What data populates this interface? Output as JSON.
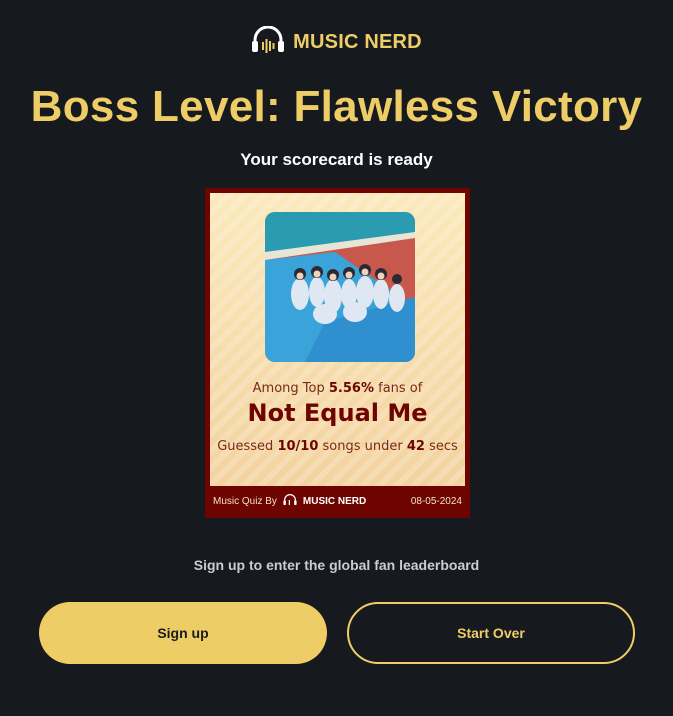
{
  "brand": {
    "name": "MUSIC NERD",
    "icon": "headphones-icon",
    "color": "#efcd66"
  },
  "title": "Boss Level: Flawless Victory",
  "subtitle": "Your scorecard is ready",
  "scorecard": {
    "image": "album-cover-group-photo",
    "among_prefix": "Among Top ",
    "percent": "5.56%",
    "among_suffix": " fans of",
    "artist": "Not Equal Me",
    "guessed_prefix": "Guessed ",
    "score": "10/10",
    "guessed_middle": " songs under ",
    "seconds": "42",
    "guessed_suffix": " secs",
    "footer_label": "Music Quiz By",
    "footer_brand": "MUSIC NERD",
    "date": "08-05-2024",
    "frame_color": "#6d0400"
  },
  "signup_prompt": "Sign up to enter the global fan leaderboard",
  "buttons": {
    "signup": "Sign up",
    "start_over": "Start Over"
  }
}
